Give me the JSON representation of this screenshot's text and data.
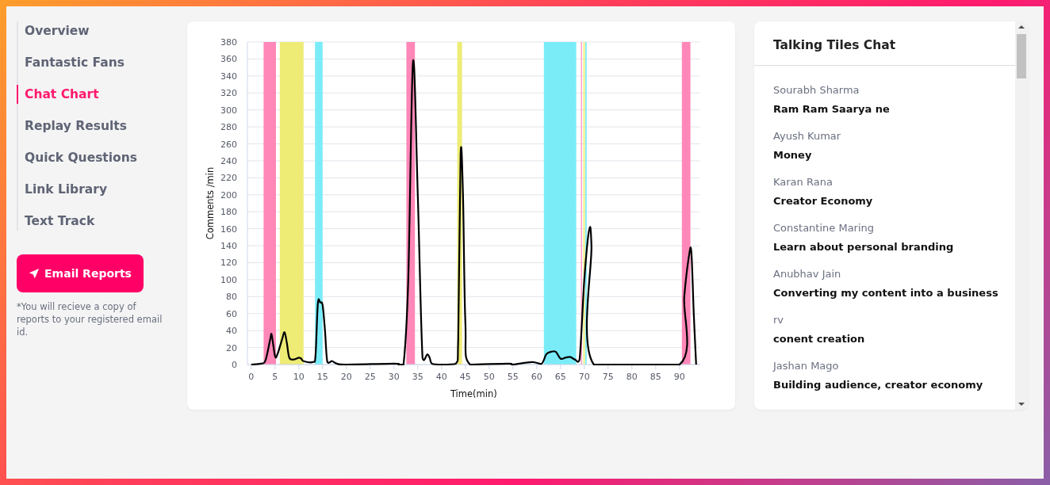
{
  "sidebar": {
    "items": [
      {
        "label": "Overview",
        "selected": false
      },
      {
        "label": "Fantastic Fans",
        "selected": false
      },
      {
        "label": "Chat Chart",
        "selected": true
      },
      {
        "label": "Replay Results",
        "selected": false
      },
      {
        "label": "Quick Questions",
        "selected": false
      },
      {
        "label": "Link Library",
        "selected": false
      },
      {
        "label": "Text Track",
        "selected": false
      }
    ],
    "email_button": "Email Reports",
    "note": "*You will recieve a copy of reports to your registered email id."
  },
  "chart": {
    "chart_data": {
      "type": "line",
      "xlabel": "Time(min)",
      "ylabel": "Comments /min",
      "x": [
        0,
        2,
        3,
        4,
        4.3,
        5,
        5.5,
        6.5,
        7,
        7.5,
        8,
        9,
        10,
        10.5,
        11,
        13,
        13.5,
        14,
        14.5,
        15,
        15.5,
        16,
        17,
        18,
        20,
        30,
        31,
        32,
        33,
        34,
        35,
        36,
        37,
        37.5,
        38,
        40,
        43,
        43.5,
        44,
        44.5,
        45,
        46,
        54,
        55,
        59,
        61,
        62,
        63,
        64,
        65,
        66,
        67,
        68,
        69,
        70,
        71,
        71.5,
        72,
        90,
        91,
        92,
        92.5,
        93,
        93.5
      ],
      "series": [
        {
          "color": "#000000",
          "values": [
            0,
            1,
            5,
            30,
            35,
            10,
            12,
            30,
            38,
            25,
            8,
            6,
            8,
            7,
            4,
            3,
            10,
            72,
            73,
            70,
            40,
            3,
            4,
            1,
            0,
            1,
            0,
            0,
            100,
            357,
            200,
            8,
            12,
            8,
            1,
            0,
            1,
            30,
            247,
            200,
            50,
            0,
            1,
            0,
            3,
            1,
            12,
            15,
            15,
            7,
            8,
            9,
            6,
            6,
            100,
            158,
            140,
            0,
            0,
            80,
            128,
            132,
            60,
            0
          ]
        }
      ],
      "xlim": [
        -0.8,
        94.3
      ],
      "ylim": [
        0,
        380
      ],
      "grid": true,
      "xticks": [
        0,
        5,
        10,
        15,
        20,
        25,
        30,
        35,
        40,
        45,
        50,
        55,
        60,
        65,
        70,
        75,
        80,
        85,
        90
      ],
      "yticks": [
        0,
        20,
        40,
        60,
        80,
        100,
        120,
        140,
        160,
        180,
        200,
        220,
        240,
        260,
        280,
        300,
        320,
        340,
        360,
        380
      ],
      "bands": [
        {
          "axis": "x",
          "from": 2.6,
          "to": 5.2,
          "color": "#ff88b8"
        },
        {
          "axis": "x",
          "from": 6,
          "to": 11,
          "color": "#eeec75"
        },
        {
          "axis": "x",
          "from": 13.4,
          "to": 15,
          "color": "#7aecf8"
        },
        {
          "axis": "x",
          "from": 32.6,
          "to": 34.4,
          "color": "#ff88b8"
        },
        {
          "axis": "x",
          "from": 43.3,
          "to": 44.3,
          "color": "#eeec75"
        },
        {
          "axis": "x",
          "from": 61.5,
          "to": 68.3,
          "color": "#7aecf8"
        },
        {
          "axis": "x",
          "from": 69.3,
          "to": 69.5,
          "color": "#ff88b8"
        },
        {
          "axis": "x",
          "from": 69.8,
          "to": 70.1,
          "color": "#eeec75"
        },
        {
          "axis": "x",
          "from": 70.2,
          "to": 70.5,
          "color": "#7aecf8"
        },
        {
          "axis": "x",
          "from": 90.5,
          "to": 92.3,
          "color": "#ff88b8"
        }
      ]
    }
  },
  "chat": {
    "title": "Talking Tiles Chat",
    "messages": [
      {
        "name": "Sourabh Sharma",
        "text": "Ram Ram Saarya ne"
      },
      {
        "name": "Ayush Kumar",
        "text": "Money"
      },
      {
        "name": "Karan Rana",
        "text": "Creator Economy"
      },
      {
        "name": "Constantine Maring",
        "text": "Learn about personal branding"
      },
      {
        "name": "Anubhav Jain",
        "text": "Converting my content into a business"
      },
      {
        "name": "rv",
        "text": "conent creation"
      },
      {
        "name": "Jashan Mago",
        "text": "Building audience, creator economy"
      }
    ]
  }
}
